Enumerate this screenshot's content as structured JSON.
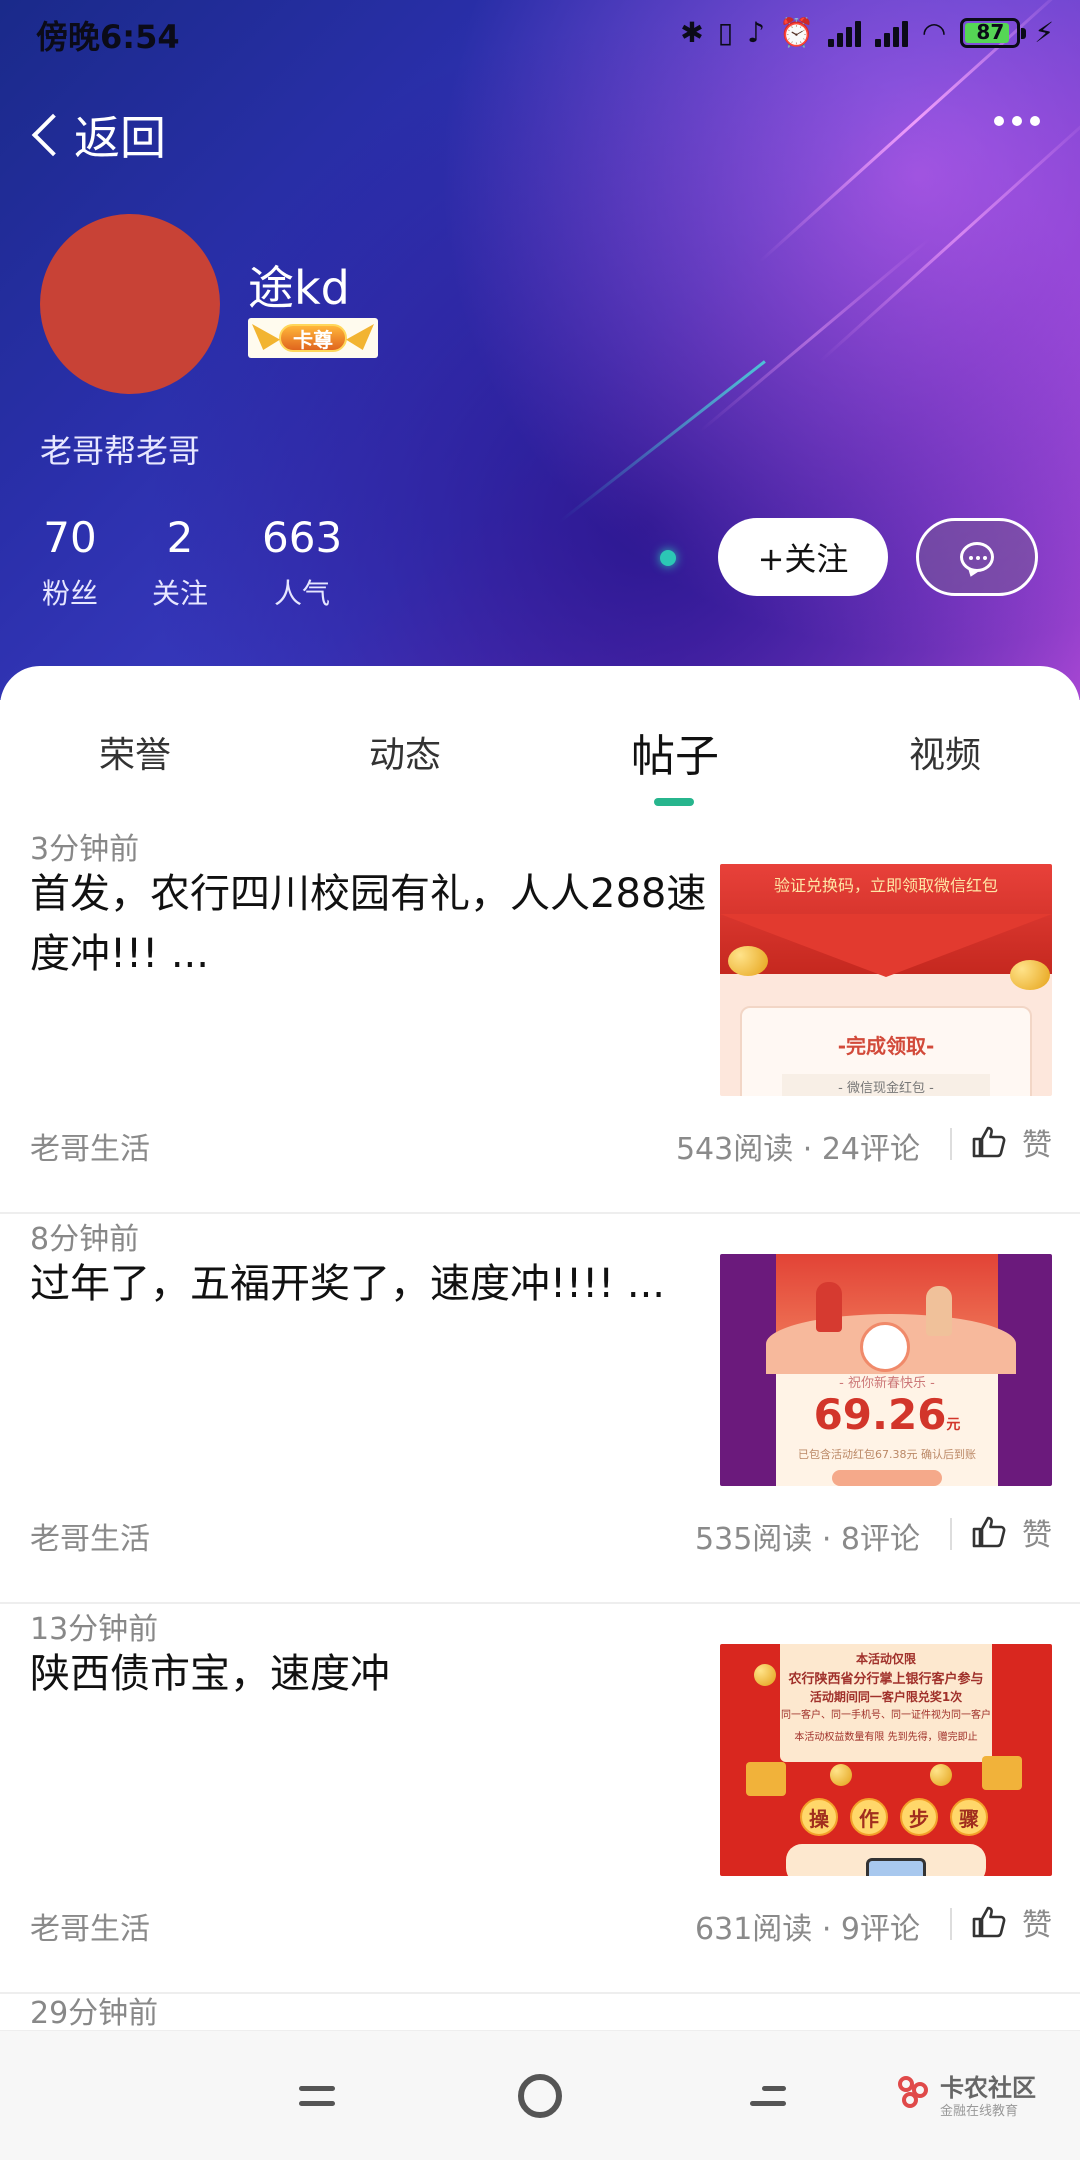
{
  "status_bar": {
    "time": "傍晚6:54",
    "battery_level": "87",
    "icons": [
      "bluetooth-icon",
      "vibrate-icon",
      "mute-icon",
      "alarm-icon",
      "signal-icon",
      "signal-icon",
      "wifi-icon",
      "battery-icon",
      "charging-icon"
    ]
  },
  "nav": {
    "back_label": "返回"
  },
  "profile": {
    "avatar_color": "#c84236",
    "username": "途kd",
    "badge_label": "卡尊",
    "motto": "老哥帮老哥",
    "stats": [
      {
        "value": "70",
        "label": "粉丝"
      },
      {
        "value": "2",
        "label": "关注"
      },
      {
        "value": "663",
        "label": "人气"
      }
    ],
    "follow_label": "+关注"
  },
  "tabs": [
    {
      "label": "荣誉",
      "active": false
    },
    {
      "label": "动态",
      "active": false
    },
    {
      "label": "帖子",
      "active": true
    },
    {
      "label": "视频",
      "active": false
    }
  ],
  "accent_color": "#27b58d",
  "posts": [
    {
      "ago": "3分钟前",
      "title": "首发，农行四川校园有礼，人人288速度冲!!! ...",
      "source": "老哥生活",
      "stats": "543阅读 · 24评论",
      "like_label": "赞",
      "thumb": {
        "caption": "验证兑换码，立即领取微信红包",
        "heading": "-完成领取-",
        "sub": "- 微信现金红包 -"
      }
    },
    {
      "ago": "8分钟前",
      "title": "过年了，五福开奖了，速度冲!!!! ...",
      "source": "老哥生活",
      "stats": "535阅读 · 8评论",
      "like_label": "赞",
      "thumb": {
        "wish": "- 祝你新春快乐 -",
        "amount": "69.26",
        "unit": "元",
        "note": "已包含活动红包67.38元 确认后到账"
      }
    },
    {
      "ago": "13分钟前",
      "title": "陕西债市宝，速度冲",
      "source": "老哥生活",
      "stats": "631阅读 · 9评论",
      "like_label": "赞",
      "thumb": {
        "line1": "本活动仅限",
        "line2": "农行陕西省分行掌上银行客户参与",
        "line3": "活动期间同一客户限兑奖1次",
        "line4": "同一客户、同一手机号、同一证件视为同一客户",
        "line5": "本活动权益数量有限 先到先得，赠完即止",
        "steps": [
          "操",
          "作",
          "步",
          "骤"
        ]
      }
    }
  ],
  "next_post_ago": "29分钟前",
  "watermark": {
    "title": "卡农社区",
    "subtitle": "金融在线教育"
  }
}
